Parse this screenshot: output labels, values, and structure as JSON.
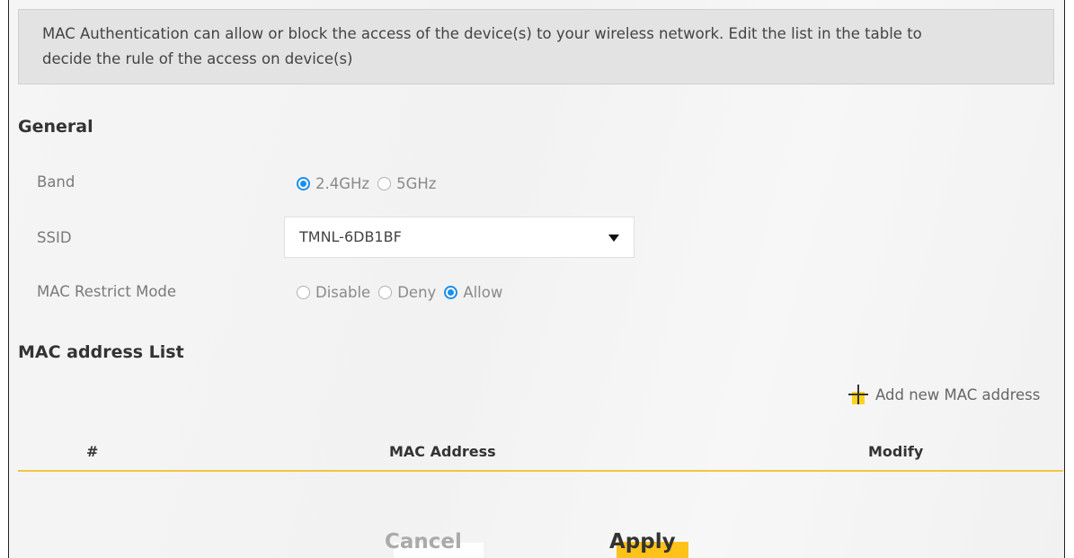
{
  "info": {
    "line1": "MAC Authentication can allow or block the access of the device(s) to your wireless network. Edit the list in the table to",
    "line2": "decide the rule of the access on device(s)"
  },
  "general": {
    "title": "General",
    "band": {
      "label": "Band",
      "options": [
        "2.4GHz",
        "5GHz"
      ],
      "selected": "2.4GHz"
    },
    "ssid": {
      "label": "SSID",
      "value": "TMNL-6DB1BF"
    },
    "mac_restrict_mode": {
      "label": "MAC Restrict Mode",
      "options": [
        "Disable",
        "Deny",
        "Allow"
      ],
      "selected": "Allow"
    }
  },
  "mac_list": {
    "title": "MAC address List",
    "add_label": "Add new MAC address",
    "columns": [
      "#",
      "MAC Address",
      "Modify"
    ],
    "rows": []
  },
  "buttons": {
    "cancel": "Cancel",
    "apply": "Apply"
  },
  "colors": {
    "accent_yellow": "#ffc21a",
    "radio_blue": "#1a8fe8",
    "table_line": "#f4c542"
  }
}
